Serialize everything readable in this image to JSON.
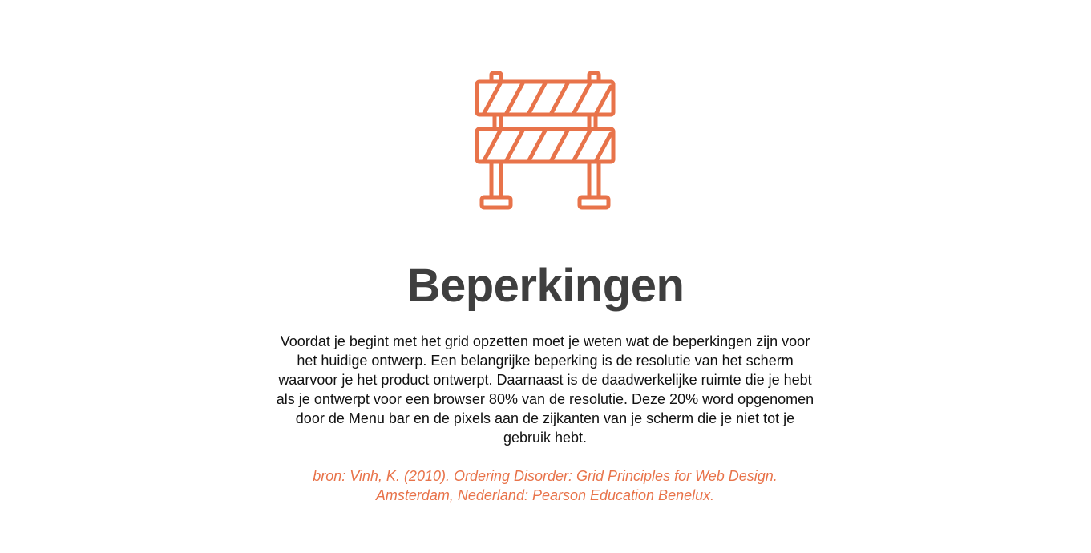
{
  "icon": "road-barrier-icon",
  "colors": {
    "accent": "#e8734a",
    "heading": "#3f3f3f",
    "text": "#111111",
    "background": "#ffffff"
  },
  "section": {
    "title": "Beperkingen",
    "body": "Voordat je begint met het grid opzetten moet je weten wat de beperkingen zijn voor het huidige ontwerp. Een belangrijke beperking is de resolutie van het scherm waarvoor je het product ontwerpt. Daarnaast is de daadwerkelijke ruimte die je hebt als je ontwerpt voor een browser 80% van de resolutie. Deze 20% word opgenomen door de Menu bar en de pixels aan de zijkanten van je scherm die je niet tot je gebruik hebt.",
    "source": "bron: Vinh, K. (2010). Ordering Disorder: Grid Principles for Web Design. Amsterdam, Nederland: Pearson Education Benelux."
  }
}
